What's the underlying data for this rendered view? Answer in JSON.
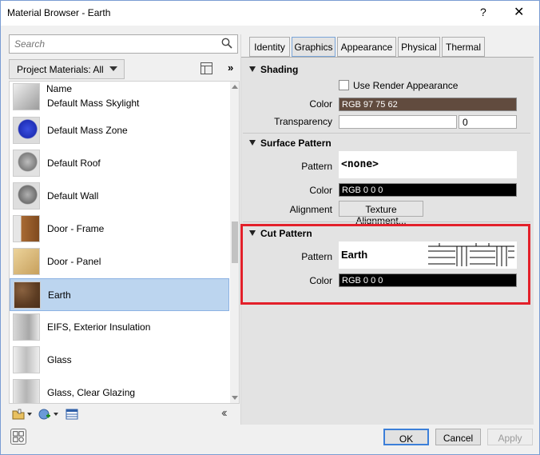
{
  "window": {
    "title": "Material Browser - Earth",
    "help": "?",
    "close": "✕"
  },
  "search": {
    "placeholder": "Search"
  },
  "filter": {
    "label": "Project Materials: All",
    "more": "»"
  },
  "list": {
    "column_header": "Name",
    "items": [
      {
        "label": "Default Mass Skylight",
        "selected": false,
        "thumb_color": "#bdbdbd"
      },
      {
        "label": "Default Mass Zone",
        "selected": false,
        "thumb_color": "#3a4fe0"
      },
      {
        "label": "Default Roof",
        "selected": false,
        "thumb_color": "#9a9a9a"
      },
      {
        "label": "Default Wall",
        "selected": false,
        "thumb_color": "#8c8c8c"
      },
      {
        "label": "Door - Frame",
        "selected": false,
        "thumb_color": "#a86a34"
      },
      {
        "label": "Door - Panel",
        "selected": false,
        "thumb_color": "#d9b977"
      },
      {
        "label": "Earth",
        "selected": true,
        "thumb_color": "#6b4a2c"
      },
      {
        "label": "EIFS, Exterior Insulation",
        "selected": false,
        "thumb_color": "#b8b8b8"
      },
      {
        "label": "Glass",
        "selected": false,
        "thumb_color": "#cfcfcf"
      },
      {
        "label": "Glass, Clear Glazing",
        "selected": false,
        "thumb_color": "#c4c4c4"
      }
    ]
  },
  "tabs": [
    {
      "label": "Identity",
      "active": false
    },
    {
      "label": "Graphics",
      "active": true
    },
    {
      "label": "Appearance",
      "active": false
    },
    {
      "label": "Physical",
      "active": false
    },
    {
      "label": "Thermal",
      "active": false
    }
  ],
  "shading": {
    "heading": "Shading",
    "use_render_label": "Use Render Appearance",
    "use_render_checked": false,
    "color_label": "Color",
    "color_value": "RGB 97 75 62",
    "color_hex": "#614b3e",
    "transparency_label": "Transparency",
    "transparency_value": "0"
  },
  "surface_pattern": {
    "heading": "Surface Pattern",
    "pattern_label": "Pattern",
    "pattern_value": "<none>",
    "color_label": "Color",
    "color_value": "RGB 0 0 0",
    "color_hex": "#000000",
    "alignment_label": "Alignment",
    "alignment_button": "Texture Alignment..."
  },
  "cut_pattern": {
    "heading": "Cut Pattern",
    "pattern_label": "Pattern",
    "pattern_value": "Earth",
    "color_label": "Color",
    "color_value": "RGB 0 0 0",
    "color_hex": "#000000"
  },
  "footer": {
    "ok": "OK",
    "cancel": "Cancel",
    "apply": "Apply"
  }
}
